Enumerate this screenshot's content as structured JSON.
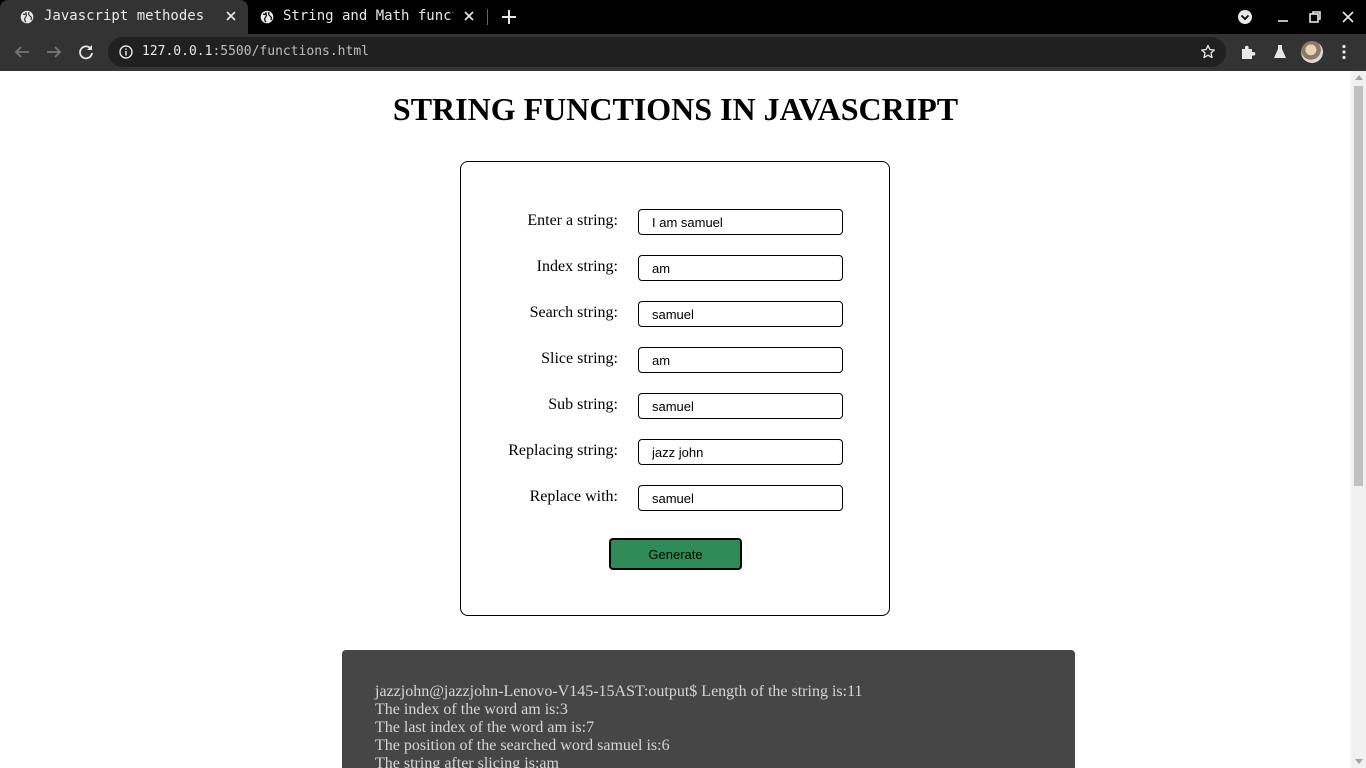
{
  "browser": {
    "tabs": [
      {
        "title": "Javascript methodes",
        "active": true
      },
      {
        "title": "String and Math functio",
        "active": false
      }
    ],
    "url_host": "127.0.0.1",
    "url_rest": ":5500/functions.html"
  },
  "page": {
    "title": "STRING FUNCTIONS IN JAVASCRIPT",
    "fields": [
      {
        "label": "Enter a string:",
        "value": "I am samuel"
      },
      {
        "label": "Index string:",
        "value": "am"
      },
      {
        "label": "Search string:",
        "value": "samuel"
      },
      {
        "label": "Slice string:",
        "value": "am"
      },
      {
        "label": "Sub string:",
        "value": "samuel"
      },
      {
        "label": "Replacing string:",
        "value": "jazz john"
      },
      {
        "label": "Replace with:",
        "value": "samuel"
      }
    ],
    "generate_label": "Generate",
    "output_lines": [
      "jazzjohn@jazzjohn-Lenovo-V145-15AST:output$ Length of the string is:11",
      "The index of the word am is:3",
      "The last index of the word am is:7",
      "The position of the searched word samuel is:6",
      "The string after slicing is:am"
    ]
  },
  "colors": {
    "generate_button": "#2e8b57",
    "output_bg": "#464646"
  }
}
